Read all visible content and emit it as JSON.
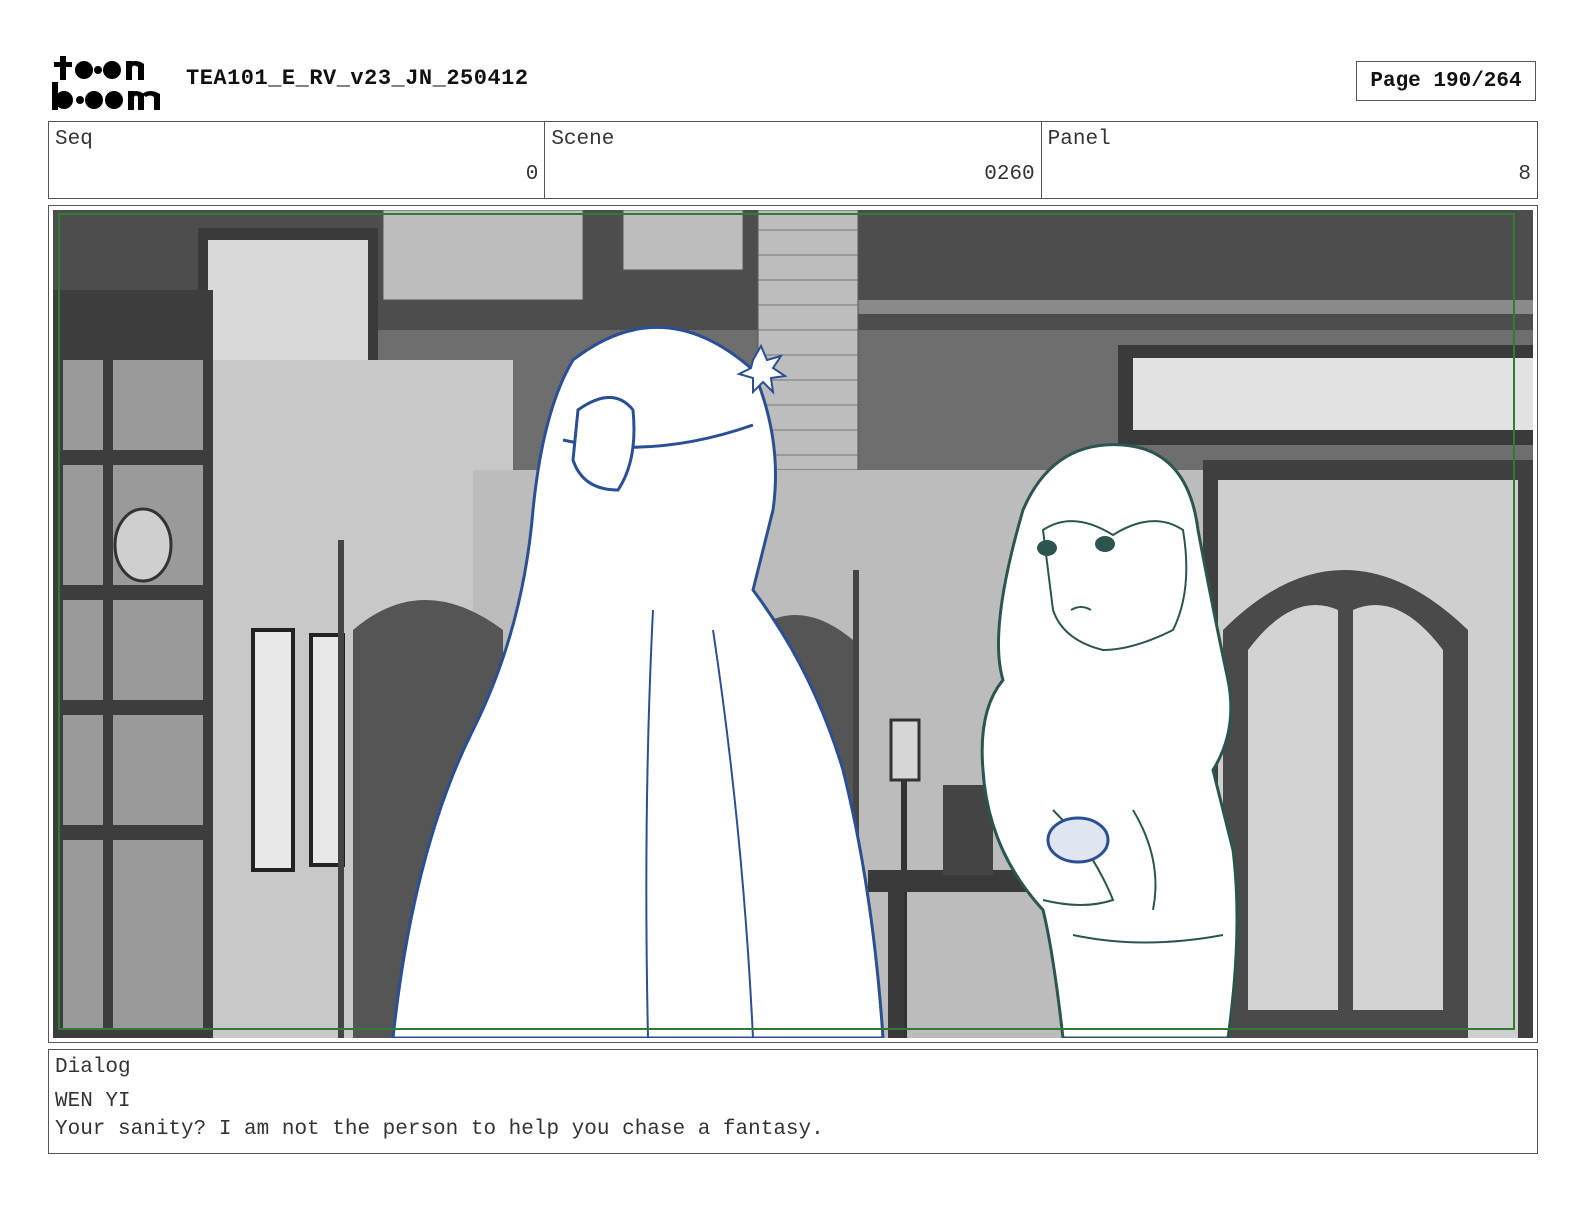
{
  "header": {
    "logo_text": "toon boom",
    "doc_title": "TEA101_E_RV_v23_JN_250412",
    "page_label": "Page 190/264"
  },
  "info": {
    "seq_label": "Seq",
    "seq_value": "0",
    "scene_label": "Scene",
    "scene_value": "0260",
    "panel_label": "Panel",
    "panel_value": "8"
  },
  "dialog": {
    "label": "Dialog",
    "speaker": "WEN YI",
    "line": "Your sanity? I am not the person to help you chase a fantasy."
  },
  "colors": {
    "safe_frame": "#2e7d32",
    "left_character_line": "#2a4f94",
    "right_character_line": "#2c5550"
  }
}
